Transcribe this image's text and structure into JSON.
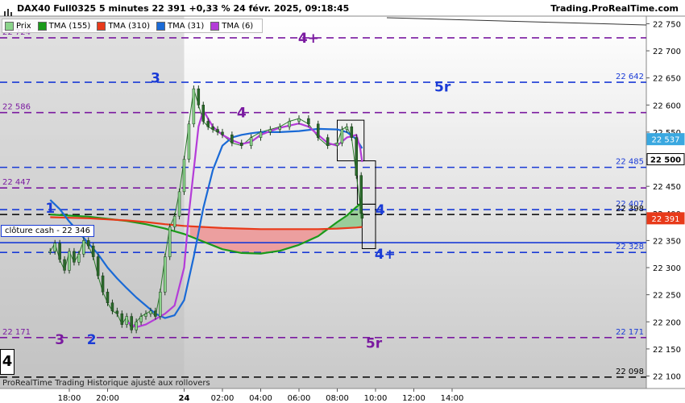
{
  "header": {
    "title": "DAX40 Full0325 5 minutes 22 391 +0,33 % 24 févr. 2025, 09:18:45",
    "brand": "Trading.ProRealTime.com"
  },
  "legend": [
    {
      "label": "Prix",
      "color": "#8bd48b"
    },
    {
      "label": "TMA (155)",
      "color": "#1a9a1a"
    },
    {
      "label": "TMA (310)",
      "color": "#e83a1a"
    },
    {
      "label": "TMA (31)",
      "color": "#1a6ad6"
    },
    {
      "label": "TMA (6)",
      "color": "#b43cd8"
    }
  ],
  "cash_label": "clôture cash -  22 346",
  "footer": "ProRealTime Trading  Historique ajusté aux rollovers",
  "corner_label": "4",
  "chart_data": {
    "type": "line",
    "x_ticks": [
      "18:00",
      "20:00",
      "24",
      "02:00",
      "04:00",
      "06:00",
      "08:00",
      "10:00",
      "12:00",
      "14:00"
    ],
    "y_ticks": [
      "22 750",
      "22 700",
      "22 650",
      "22 600",
      "22 550",
      "22 500",
      "22 450",
      "22 400",
      "22 350",
      "22 300",
      "22 250",
      "22 200",
      "22 150",
      "22 100"
    ],
    "ylim": [
      22077,
      22764
    ],
    "levels": [
      {
        "value": 22724,
        "left_label": "22 724",
        "right_label": "",
        "tag": "4+",
        "color": "#7a1aa0",
        "style": "dash"
      },
      {
        "value": 22642,
        "left_label": "",
        "right_label": "22 642",
        "tag": "3",
        "color": "#1a3bd6",
        "style": "dash"
      },
      {
        "value": 22586,
        "left_label": "22 586",
        "right_label": "",
        "tag": "4",
        "color": "#7a1aa0",
        "style": "dash"
      },
      {
        "value": 22485,
        "left_label": "",
        "right_label": "22 485",
        "tag": "",
        "color": "#1a3bd6",
        "style": "dash"
      },
      {
        "value": 22447,
        "left_label": "22 447",
        "right_label": "",
        "tag": "",
        "color": "#7a1aa0",
        "style": "dash"
      },
      {
        "value": 22407,
        "left_label": "",
        "right_label": "22 407",
        "tag": "1",
        "color": "#1a3bd6",
        "style": "dash"
      },
      {
        "value": 22398,
        "left_label": "",
        "right_label": "22 398",
        "tag": "",
        "color": "#000000",
        "style": "dash"
      },
      {
        "value": 22346,
        "left_label": "",
        "right_label": "",
        "tag": "",
        "color": "#1a3bd6",
        "style": "solid"
      },
      {
        "value": 22328,
        "left_label": "",
        "right_label": "22 328",
        "tag": "4+",
        "color": "#1a3bd6",
        "style": "dash"
      },
      {
        "value": 22171,
        "left_label": "22 171",
        "right_label": "22 171",
        "tag": "3",
        "color": "#7a1aa0",
        "style": "dash"
      },
      {
        "value": 22098,
        "left_label": "",
        "right_label": "22 098",
        "tag": "",
        "color": "#000000",
        "style": "dash"
      }
    ],
    "level_tags": [
      {
        "text": "4+",
        "color": "#7a1aa0",
        "x_time": "06:30",
        "value": 22724
      },
      {
        "text": "3",
        "color": "#1a3bd6",
        "x_time": "22:30",
        "value": 22650
      },
      {
        "text": "5r",
        "color": "#1a3bd6",
        "x_time": "13:30",
        "value": 22634
      },
      {
        "text": "4",
        "color": "#7a1aa0",
        "x_time": "03:00",
        "value": 22586
      },
      {
        "text": "1",
        "color": "#1a3bd6",
        "x_time": "17:00",
        "value": 22410
      },
      {
        "text": "4",
        "color": "#1a3bd6",
        "x_time": "10:15",
        "value": 22407
      },
      {
        "text": "4+",
        "color": "#1a3bd6",
        "x_time": "10:30",
        "value": 22325
      },
      {
        "text": "3",
        "color": "#7a1aa0",
        "x_time": "17:30",
        "value": 22168
      },
      {
        "text": "2",
        "color": "#1a3bd6",
        "x_time": "19:10",
        "value": 22168
      },
      {
        "text": "5r",
        "color": "#7a1aa0",
        "x_time": "09:55",
        "value": 22161
      }
    ],
    "price_tags": [
      {
        "text": "22 537",
        "value": 22537,
        "color": "#3aa8e0"
      },
      {
        "text": "22 500",
        "value": 22500,
        "color": "#ffffff"
      },
      {
        "text": "22 391",
        "value": 22391,
        "color": "#e83a1a"
      }
    ],
    "series": [
      {
        "name": "Prix",
        "color": "#2a7a2a",
        "x_hours": [
          -7.0,
          -6.75,
          -6.5,
          -6.25,
          -6.0,
          -5.75,
          -5.5,
          -5.25,
          -5.0,
          -4.75,
          -4.5,
          -4.25,
          -4.0,
          -3.75,
          -3.5,
          -3.25,
          -3.0,
          -2.75,
          -2.5,
          -2.25,
          -2.0,
          -1.75,
          -1.5,
          -1.25,
          -1.0,
          -0.75,
          -0.5,
          -0.25,
          0.0,
          0.25,
          0.5,
          0.75,
          1.0,
          1.25,
          1.5,
          1.75,
          2.0,
          2.5,
          3.0,
          3.5,
          4.0,
          4.5,
          5.0,
          5.5,
          6.0,
          6.5,
          7.0,
          7.5,
          8.0,
          8.25,
          8.5,
          8.75,
          9.0,
          9.25,
          9.3
        ],
        "values": [
          22330,
          22345,
          22315,
          22295,
          22330,
          22310,
          22325,
          22350,
          22340,
          22320,
          22285,
          22255,
          22235,
          22220,
          22215,
          22195,
          22210,
          22185,
          22200,
          22210,
          22215,
          22220,
          22210,
          22255,
          22320,
          22375,
          22395,
          22440,
          22500,
          22565,
          22630,
          22600,
          22570,
          22560,
          22555,
          22550,
          22545,
          22530,
          22525,
          22540,
          22550,
          22555,
          22560,
          22570,
          22575,
          22565,
          22540,
          22525,
          22530,
          22555,
          22560,
          22540,
          22470,
          22400,
          22391
        ]
      },
      {
        "name": "TMA (155)",
        "color": "#1a9a1a",
        "x_hours": [
          -7.0,
          -6.0,
          -5.0,
          -4.0,
          -3.0,
          -2.0,
          -1.0,
          0.0,
          0.5,
          1.0,
          2.0,
          3.0,
          4.0,
          5.0,
          6.0,
          7.0,
          8.0,
          8.5,
          9.0,
          9.3
        ],
        "values": [
          22398,
          22396,
          22394,
          22390,
          22386,
          22380,
          22372,
          22362,
          22355,
          22348,
          22334,
          22327,
          22326,
          22331,
          22342,
          22358,
          22384,
          22396,
          22412,
          22420
        ]
      },
      {
        "name": "TMA (310)",
        "color": "#e83a1a",
        "x_hours": [
          -7.0,
          -6.0,
          -5.0,
          -4.0,
          -3.0,
          -2.0,
          -1.0,
          0.0,
          1.0,
          2.0,
          3.0,
          4.0,
          5.0,
          6.0,
          7.0,
          8.0,
          9.0,
          9.3
        ],
        "values": [
          22393,
          22392,
          22391,
          22389,
          22387,
          22384,
          22380,
          22377,
          22375,
          22373,
          22372,
          22371,
          22371,
          22371,
          22371,
          22372,
          22374,
          22375
        ]
      },
      {
        "name": "TMA (31)",
        "color": "#1a6ad6",
        "x_hours": [
          -7.0,
          -6.5,
          -6.0,
          -5.5,
          -5.0,
          -4.5,
          -4.0,
          -3.5,
          -3.0,
          -2.5,
          -2.0,
          -1.5,
          -1.0,
          -0.5,
          0.0,
          0.5,
          1.0,
          1.5,
          2.0,
          2.5,
          3.0,
          3.5,
          4.0,
          5.0,
          6.0,
          7.0,
          8.0,
          8.5,
          9.0,
          9.3
        ],
        "values": [
          22425,
          22408,
          22385,
          22365,
          22345,
          22325,
          22300,
          22280,
          22262,
          22245,
          22230,
          22215,
          22207,
          22212,
          22240,
          22320,
          22410,
          22480,
          22525,
          22540,
          22545,
          22548,
          22550,
          22550,
          22552,
          22556,
          22555,
          22550,
          22537,
          22520
        ]
      },
      {
        "name": "TMA (6)",
        "color": "#b43cd8",
        "x_hours": [
          -3.0,
          -2.5,
          -2.0,
          -1.5,
          -1.0,
          -0.5,
          0.0,
          0.25,
          0.5,
          0.75,
          1.0,
          1.5,
          2.0,
          2.5,
          3.0,
          3.5,
          4.0,
          4.5,
          5.0,
          5.5,
          6.0,
          6.5,
          7.0,
          7.5,
          8.0,
          8.5,
          9.0,
          9.2,
          9.3
        ],
        "values": [
          22200,
          22190,
          22195,
          22205,
          22215,
          22230,
          22300,
          22400,
          22480,
          22560,
          22590,
          22560,
          22545,
          22535,
          22528,
          22532,
          22545,
          22552,
          22558,
          22562,
          22566,
          22560,
          22545,
          22530,
          22525,
          22540,
          22545,
          22520,
          22495
        ]
      }
    ],
    "grid": false,
    "legend_position": "top-left"
  }
}
